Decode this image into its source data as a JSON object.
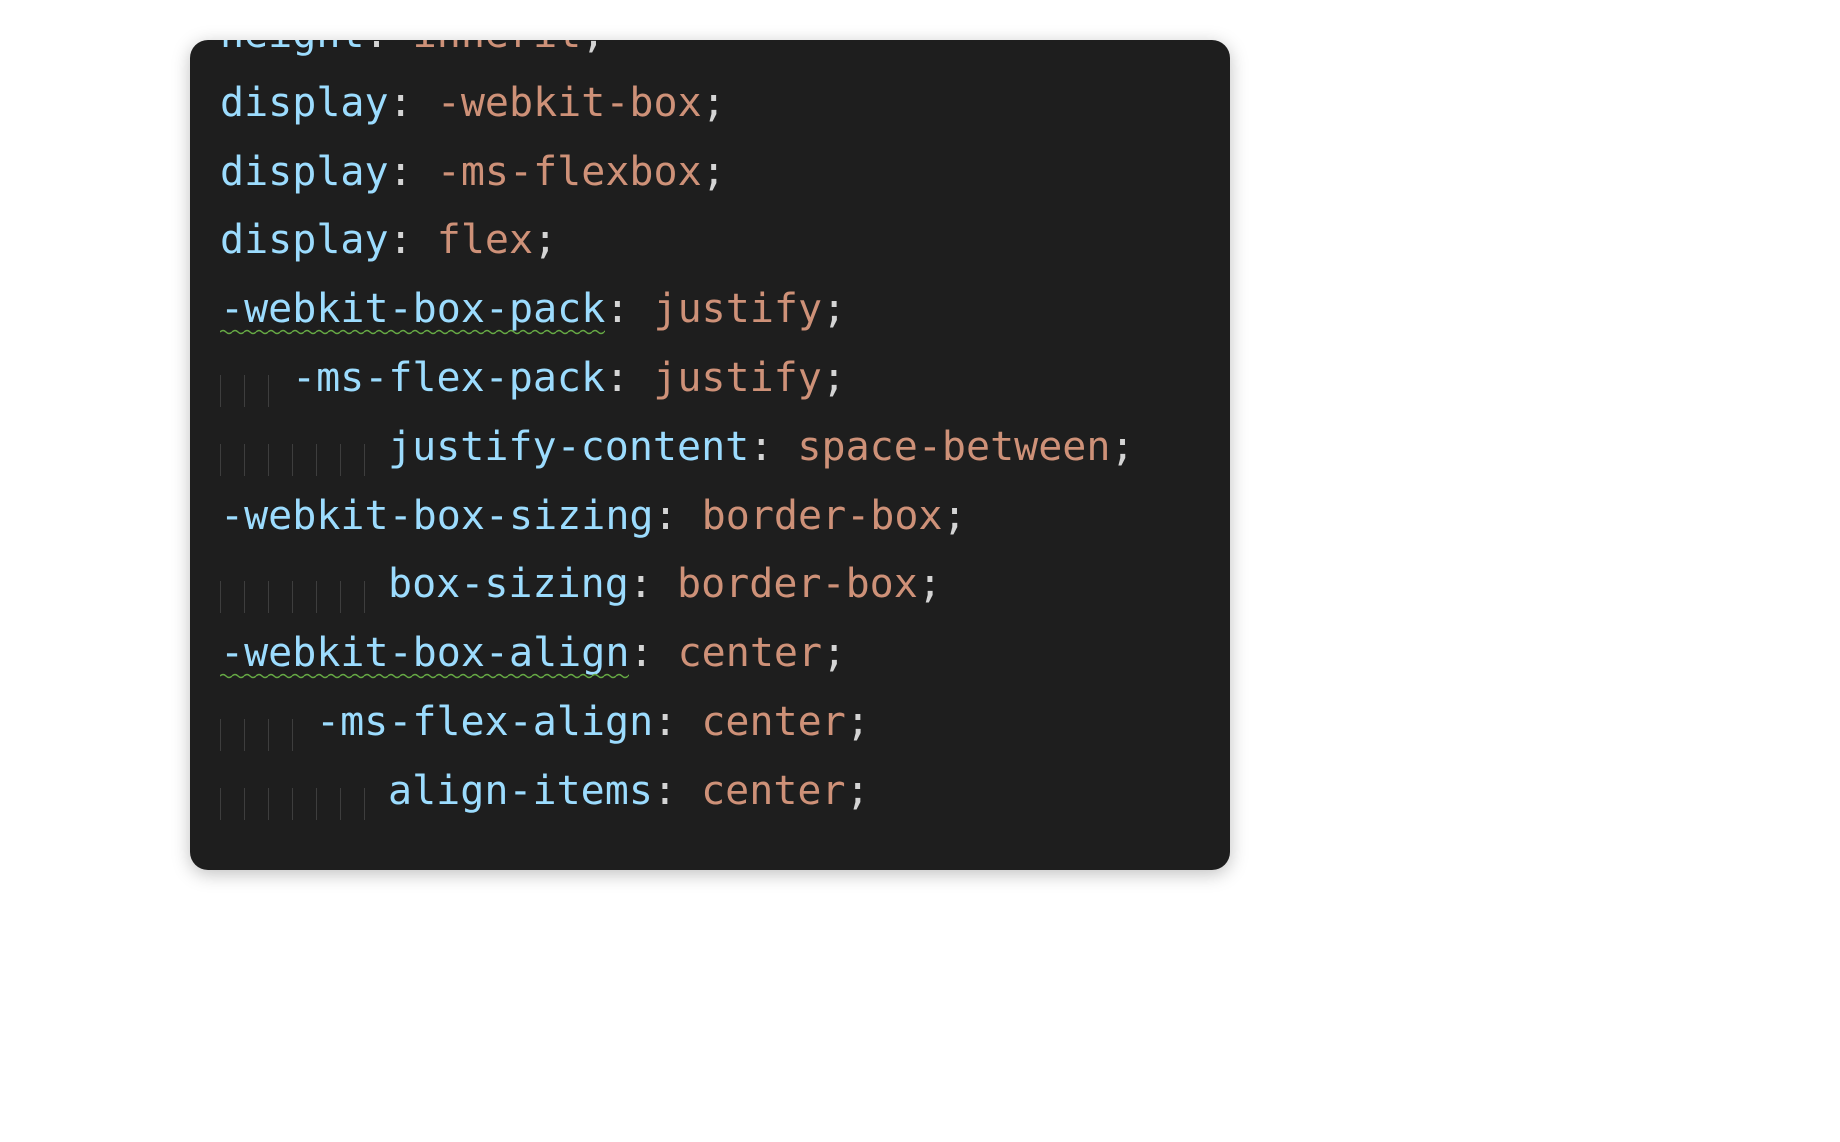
{
  "editor": {
    "lines": [
      {
        "indent": 0,
        "prop": "height",
        "squiggle": false,
        "colon": ": ",
        "value": "inherit",
        "tail": ";"
      },
      {
        "indent": 0,
        "prop": "display",
        "squiggle": false,
        "colon": ": ",
        "value": "-webkit-box",
        "tail": ";"
      },
      {
        "indent": 0,
        "prop": "display",
        "squiggle": false,
        "colon": ": ",
        "value": "-ms-flexbox",
        "tail": ";"
      },
      {
        "indent": 0,
        "prop": "display",
        "squiggle": false,
        "colon": ": ",
        "value": "flex",
        "tail": ";"
      },
      {
        "indent": 0,
        "prop": "-webkit-box-pack",
        "squiggle": true,
        "colon": ": ",
        "value": "justify",
        "tail": ";"
      },
      {
        "indent": 3,
        "prop": "-ms-flex-pack",
        "squiggle": false,
        "colon": ": ",
        "value": "justify",
        "tail": ";"
      },
      {
        "indent": 7,
        "prop": "justify-content",
        "squiggle": false,
        "colon": ": ",
        "value": "space-between",
        "tail": ";"
      },
      {
        "indent": 0,
        "prop": "-webkit-box-sizing",
        "squiggle": false,
        "colon": ": ",
        "value": "border-box",
        "tail": ";"
      },
      {
        "indent": 7,
        "prop": "box-sizing",
        "squiggle": false,
        "colon": ": ",
        "value": "border-box",
        "tail": ";"
      },
      {
        "indent": 0,
        "prop": "-webkit-box-align",
        "squiggle": true,
        "colon": ": ",
        "value": "center",
        "tail": ";"
      },
      {
        "indent": 4,
        "prop": "-ms-flex-align",
        "squiggle": false,
        "colon": ": ",
        "value": "center",
        "tail": ";"
      },
      {
        "indent": 7,
        "prop": "align-items",
        "squiggle": false,
        "colon": ": ",
        "value": "center",
        "tail": ";"
      }
    ]
  }
}
